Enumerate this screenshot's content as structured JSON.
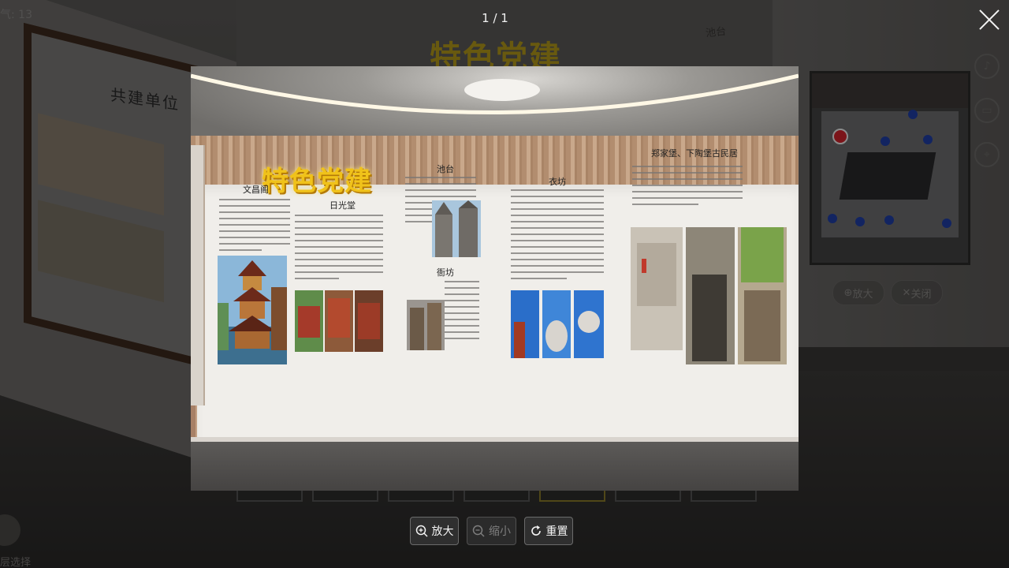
{
  "viewer": {
    "counter": "1 / 1",
    "close_label": "×"
  },
  "toolbar": {
    "zoom_in_label": "放大",
    "zoom_out_label": "缩小",
    "reset_label": "重置"
  },
  "exhibit": {
    "title": "特色党建",
    "headings": [
      "文昌阁",
      "日光堂",
      "池台",
      "衙坊",
      "衣坊",
      "郑家堡、下陶堡古民居"
    ]
  },
  "background": {
    "weather": "气: 13",
    "wall_text": "共建单位",
    "back_heading": "池台",
    "bottom_left_label": "层选择",
    "zoom_label": "放大",
    "close_label": "关闭"
  },
  "icons": [
    "close-icon",
    "zoom-in-icon",
    "zoom-out-icon",
    "reset-icon",
    "music-icon",
    "vr-icon",
    "location-icon"
  ]
}
